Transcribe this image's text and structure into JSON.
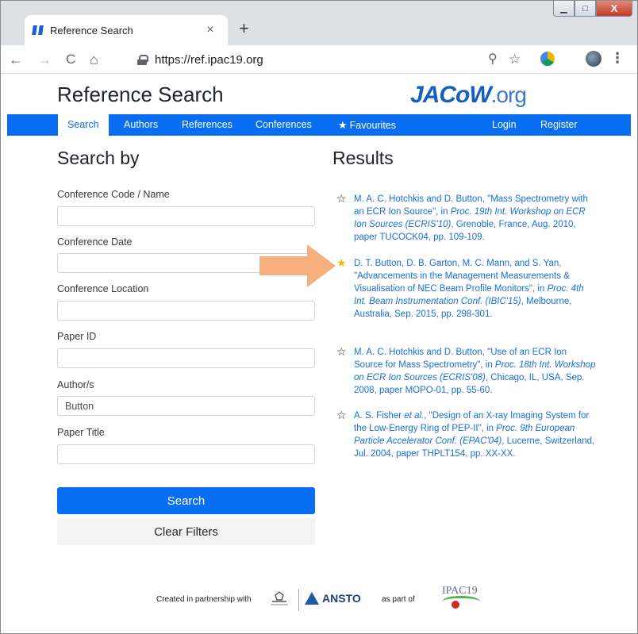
{
  "browser": {
    "tab_title": "Reference Search",
    "tab_close": "×",
    "new_tab": "+",
    "url": "https://ref.ipac19.org",
    "back": "←",
    "forward": "→",
    "reload": "C",
    "home": "⌂",
    "zoom_icon": "⚲",
    "bookmark_icon": "☆",
    "menu_icon": "⋮",
    "window_buttons": {
      "minimize": "▁",
      "maximize": "□",
      "close": "X"
    }
  },
  "site": {
    "title": "Reference Search",
    "logo": {
      "main": "JACoW",
      "suffix": ".org"
    }
  },
  "nav": {
    "items": [
      "Search",
      "Authors",
      "References",
      "Conferences"
    ],
    "favourites": "Favourites",
    "login": "Login",
    "register": "Register",
    "active": "Search"
  },
  "search": {
    "heading": "Search by",
    "fields": [
      {
        "label": "Conference Code / Name",
        "value": ""
      },
      {
        "label": "Conference Date",
        "value": ""
      },
      {
        "label": "Conference Location",
        "value": ""
      },
      {
        "label": "Paper ID",
        "value": ""
      },
      {
        "label": "Author/s",
        "value": "Button"
      },
      {
        "label": "Paper Title",
        "value": ""
      }
    ],
    "search_button": "Search",
    "clear_button": "Clear Filters"
  },
  "results": {
    "heading": "Results",
    "items": [
      {
        "favourite": false,
        "authors": "M. A. C. Hotchkis and D. Button",
        "title_part": ", \"Mass Spectrometry with an ECR Ion Source\", in ",
        "venue": "Proc. 19th Int. Workshop on ECR Ion Sources (ECRIS'10)",
        "rest": ", Grenoble, France, Aug. 2010, paper TUCOCK04, pp. 109-109."
      },
      {
        "favourite": true,
        "authors": "D. T. Button, D. B. Garton, M. C. Mann, and S. Yan",
        "title_part": ", \"Advancements in the Management Measurements & Visualisation of NEC Beam Profile Monitors\", in ",
        "venue": "Proc. 4th Int. Beam Instrumentation Conf. (IBIC'15)",
        "rest": ", Melbourne, Australia, Sep. 2015, pp. 298-301."
      },
      {
        "favourite": false,
        "authors": "M. A. C. Hotchkis and D. Button",
        "title_part": ", \"Use of an ECR Ion Source for Mass Spectrometry\", in ",
        "venue": "Proc. 18th Int. Workshop on ECR Ion Sources (ECRIS'08)",
        "rest": ", Chicago, IL, USA, Sep. 2008, paper MOPO-01, pp. 55-60."
      },
      {
        "favourite": false,
        "authors": "A. S. Fisher ",
        "etal": "et al.",
        "title_part": ", \"Design of an X-ray Imaging System for the Low-Energy Ring of PEP-II\", in ",
        "venue": "Proc. 9th European Particle Accelerator Conf. (EPAC'04)",
        "rest": ", Lucerne, Switzerland, Jul. 2004, paper THPLT154, pp. XX-XX."
      }
    ]
  },
  "footer": {
    "partnership": "Created in partnership with",
    "ansto": "ANSTO",
    "part_of": "as part of",
    "ipac": "IPAC19"
  },
  "colors": {
    "brand_blue": "#0a6ef2",
    "link_blue": "#1a6ee0",
    "favourite_star": "#f5b800",
    "arrow": "#f5b07e"
  }
}
